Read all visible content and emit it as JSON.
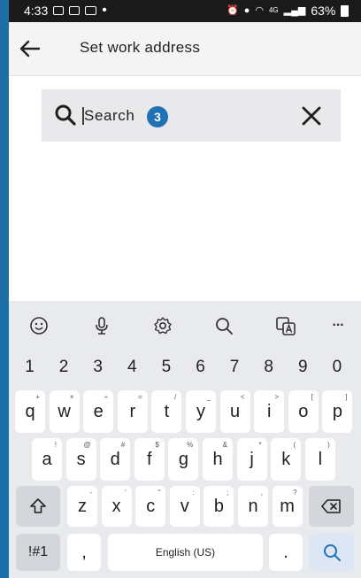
{
  "status_bar": {
    "time": "4:33",
    "battery": "63%",
    "network": "4G"
  },
  "header": {
    "title": "Set work address"
  },
  "search": {
    "value": "Search",
    "badge": "3"
  },
  "keyboard": {
    "toolbar": [
      "emoji-icon",
      "microphone-icon",
      "settings-icon",
      "search-icon",
      "translate-icon",
      "more-icon"
    ],
    "more_label": "···",
    "number_row": [
      "1",
      "2",
      "3",
      "4",
      "5",
      "6",
      "7",
      "8",
      "9",
      "0"
    ],
    "row1": [
      {
        "k": "q",
        "h": "+"
      },
      {
        "k": "w",
        "h": "×"
      },
      {
        "k": "e",
        "h": "÷"
      },
      {
        "k": "r",
        "h": "="
      },
      {
        "k": "t",
        "h": "/"
      },
      {
        "k": "y",
        "h": "_"
      },
      {
        "k": "u",
        "h": "<"
      },
      {
        "k": "i",
        "h": ">"
      },
      {
        "k": "o",
        "h": "["
      },
      {
        "k": "p",
        "h": "]"
      }
    ],
    "row2": [
      {
        "k": "a",
        "h": "!"
      },
      {
        "k": "s",
        "h": "@"
      },
      {
        "k": "d",
        "h": "#"
      },
      {
        "k": "f",
        "h": "$"
      },
      {
        "k": "g",
        "h": "%"
      },
      {
        "k": "h",
        "h": "&"
      },
      {
        "k": "j",
        "h": "*"
      },
      {
        "k": "k",
        "h": "("
      },
      {
        "k": "l",
        "h": ")"
      }
    ],
    "row3": [
      {
        "k": "z",
        "h": "-"
      },
      {
        "k": "x",
        "h": "'"
      },
      {
        "k": "c",
        "h": "\""
      },
      {
        "k": "v",
        "h": ":"
      },
      {
        "k": "b",
        "h": ";"
      },
      {
        "k": "n",
        "h": ","
      },
      {
        "k": "m",
        "h": "?"
      }
    ],
    "symbols_label": "!#1",
    "comma_label": ",",
    "space_label": "English (US)",
    "period_label": "."
  }
}
